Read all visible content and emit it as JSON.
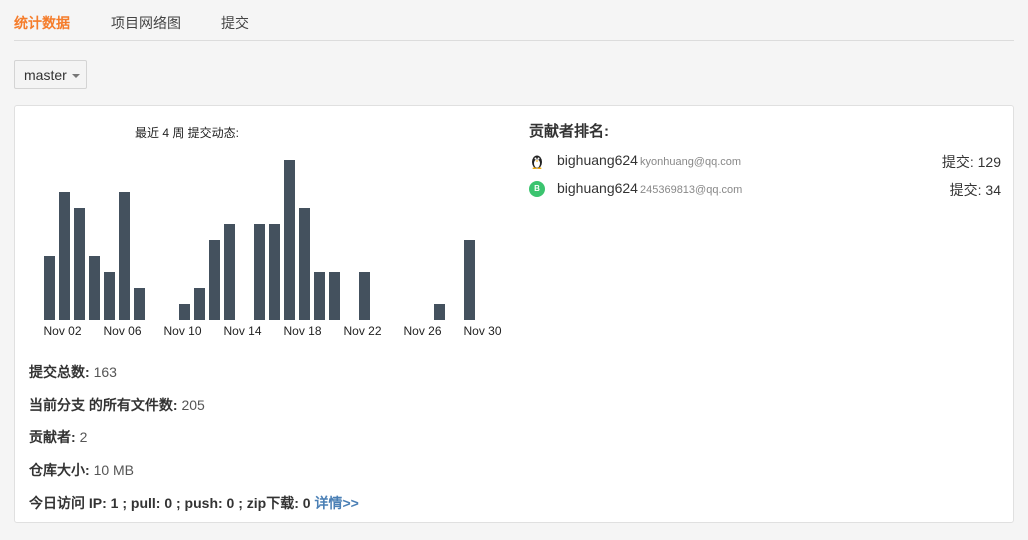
{
  "tabs": [
    {
      "label": "统计数据",
      "active": true
    },
    {
      "label": "项目网络图",
      "active": false
    },
    {
      "label": "提交",
      "active": false
    }
  ],
  "branch": {
    "label": "master",
    "icon": "caret-down-icon"
  },
  "chart_title": "最近 4 周 提交动态:",
  "chart_data": {
    "type": "bar",
    "color": "#44515e",
    "x": [
      "Nov 02",
      "Nov 03",
      "Nov 04",
      "Nov 05",
      "Nov 06",
      "Nov 07",
      "Nov 08",
      "Nov 09",
      "Nov 10",
      "Nov 11",
      "Nov 12",
      "Nov 13",
      "Nov 14",
      "Nov 15",
      "Nov 16",
      "Nov 17",
      "Nov 18",
      "Nov 19",
      "Nov 20",
      "Nov 21",
      "Nov 22",
      "Nov 23",
      "Nov 24",
      "Nov 25",
      "Nov 26",
      "Nov 27",
      "Nov 28",
      "Nov 29",
      "Nov 30"
    ],
    "values": [
      4,
      8,
      7,
      4,
      3,
      8,
      2,
      0,
      0,
      1,
      2,
      5,
      6,
      0,
      6,
      6,
      10,
      7,
      3,
      3,
      0,
      3,
      0,
      0,
      0,
      0,
      1,
      0,
      5
    ],
    "tick_labels": [
      "Nov 02",
      "Nov 06",
      "Nov 10",
      "Nov 14",
      "Nov 18",
      "Nov 22",
      "Nov 26",
      "Nov 30"
    ],
    "ylim": [
      0,
      10
    ]
  },
  "stats": {
    "total_commits_label": "提交总数:",
    "total_commits": "163",
    "files_label": "当前分支 的所有文件数:",
    "files": "205",
    "contributors_label": "贡献者:",
    "contributors": "2",
    "repo_size_label": "仓库大小:",
    "repo_size": "10 MB",
    "visits": "今日访问 IP: 1 ; pull: 0 ; push: 0 ; zip下载: 0",
    "details_link": "详情>>"
  },
  "ranking": {
    "title": "贡献者排名:",
    "contributors": [
      {
        "name": "bighuang624",
        "email": "kyonhuang@qq.com",
        "commits": "提交: 129",
        "avatar": "penguin-avatar"
      },
      {
        "name": "bighuang624",
        "email": "245369813@qq.com",
        "commits": "提交: 34",
        "avatar": "B",
        "avatar_color": "#3bc46f"
      }
    ]
  }
}
